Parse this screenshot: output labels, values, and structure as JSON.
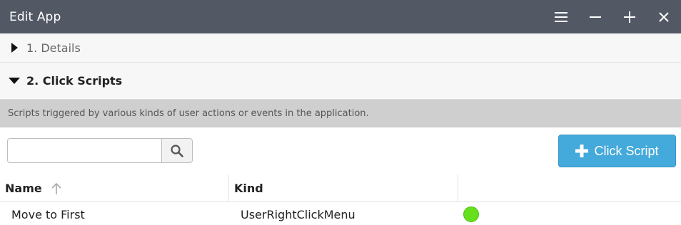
{
  "window": {
    "title": "Edit App",
    "controls": [
      "menu-icon",
      "minimize-icon",
      "maximize-icon",
      "close-icon"
    ]
  },
  "sections": [
    {
      "label": "1. Details",
      "expanded": false
    },
    {
      "label": "2. Click Scripts",
      "expanded": true
    }
  ],
  "description": "Scripts triggered by various kinds of user actions or events in the application.",
  "toolbar": {
    "search_value": "",
    "search_placeholder": "",
    "add_label": "Click Script"
  },
  "table": {
    "columns": [
      "Name",
      "Kind",
      ""
    ],
    "rows": [
      {
        "name": "Move to First",
        "kind": "UserRightClickMenu",
        "status": "enabled"
      }
    ]
  },
  "colors": {
    "titlebar": "#535865",
    "accent": "#44a9db",
    "status_enabled": "#66e01d"
  }
}
